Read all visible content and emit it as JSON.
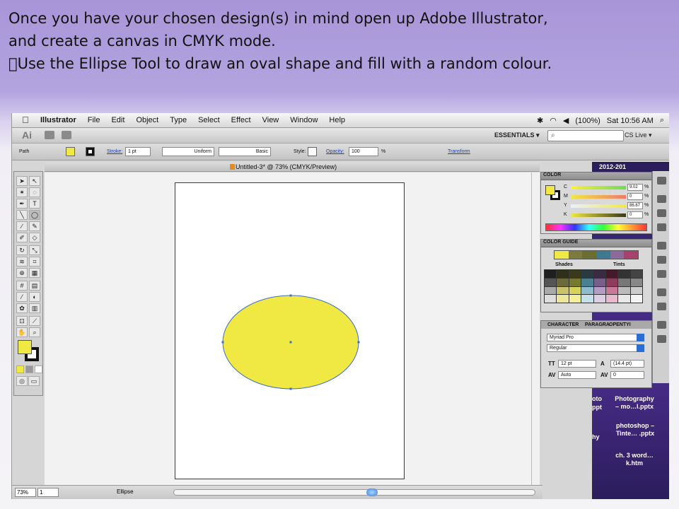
{
  "slide": {
    "line1": "Once you have your chosen design(s) in mind open up Adobe Illustrator,",
    "line2": "and create a canvas in CMYK mode.",
    "line3": "Use the Ellipse Tool to draw an oval shape and fill with a random colour."
  },
  "menubar": {
    "apple": "",
    "items": [
      "Illustrator",
      "File",
      "Edit",
      "Object",
      "Type",
      "Select",
      "Effect",
      "View",
      "Window",
      "Help"
    ],
    "battery": "(100%)",
    "clock": "Sat 10:56 AM"
  },
  "appbar": {
    "logo": "Ai",
    "workspace": "ESSENTIALS ▾",
    "search_placeholder": "⌕",
    "cslive": "CS Live ▾"
  },
  "control": {
    "path_label": "Path",
    "stroke_label": "Stroke:",
    "stroke_value": "1 pt",
    "profile": "Uniform",
    "brush": "Basic",
    "style_label": "Style:",
    "opacity_label": "Opacity:",
    "opacity_value": "100",
    "percent": "%",
    "transform_label": "Transform"
  },
  "document": {
    "tab_title": "Untitled-3* @ 73% (CMYK/Preview)"
  },
  "artwork": {
    "fill_color": "#f0e944",
    "stroke_color": "#3c6ec8"
  },
  "color_panel": {
    "title": "COLOR",
    "channels": [
      {
        "name": "C",
        "value": "9.02",
        "unit": "%"
      },
      {
        "name": "M",
        "value": "0",
        "unit": "%"
      },
      {
        "name": "Y",
        "value": "86.67",
        "unit": "%"
      },
      {
        "name": "K",
        "value": "0",
        "unit": "%"
      }
    ]
  },
  "guide_panel": {
    "title": "COLOR GUIDE",
    "shades": "Shades",
    "tints": "Tints",
    "strip": [
      "#f0e944",
      "#7d7a3e",
      "#6a6f2f",
      "#3e7a8f",
      "#8c6a9c",
      "#a6426c"
    ]
  },
  "char_panel": {
    "tabs": [
      "CHARACTER",
      "PARAGRA",
      "OPENTYI"
    ],
    "font": "Myriad Pro",
    "style": "Regular",
    "size": "12 pt",
    "leading": "(14.4 pt)",
    "kerning": "Auto",
    "tracking": "0"
  },
  "statusbar": {
    "zoom": "73%",
    "page": "1",
    "tool": "Ellipse"
  },
  "desktop": {
    "year": "2012-201",
    "pptx_tail": "pptx",
    "photo": "Photography – mo…l.pptx",
    "photoshop": "photoshop – Tinte… .pptx",
    "word": "ch. 3 word…k.htm",
    "oto": "oto",
    "ppt": "ppt",
    "hy": "hy"
  }
}
